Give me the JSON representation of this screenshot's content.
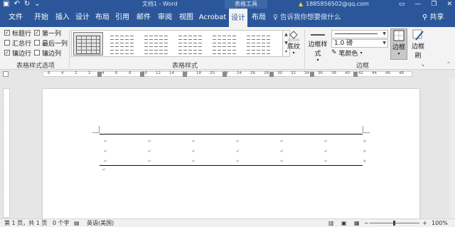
{
  "titlebar": {
    "doc_title": "文档1 - Word",
    "context_title": "表格工具",
    "account": "1885856502@qq.com",
    "qat_icons": [
      "save-icon",
      "undo-icon",
      "redo-icon",
      "quick-access-dropdown-icon"
    ],
    "window_buttons": [
      "ribbon-display-options-icon",
      "minimize-icon",
      "restore-icon",
      "close-icon"
    ]
  },
  "tabs": [
    {
      "label": "文件"
    },
    {
      "label": "开始"
    },
    {
      "label": "插入"
    },
    {
      "label": "设计"
    },
    {
      "label": "布局"
    },
    {
      "label": "引用"
    },
    {
      "label": "邮件"
    },
    {
      "label": "审阅"
    },
    {
      "label": "视图"
    },
    {
      "label": "Acrobat"
    },
    {
      "label": "设计"
    },
    {
      "label": "布局"
    }
  ],
  "tell_me": "告诉我你想要做什么",
  "share": "共享",
  "ribbon": {
    "style_options": {
      "label": "表格样式选项",
      "checkboxes": [
        {
          "label": "标题行",
          "checked": true
        },
        {
          "label": "第一列",
          "checked": true
        },
        {
          "label": "汇总行",
          "checked": false
        },
        {
          "label": "最后一列",
          "checked": false
        },
        {
          "label": "镶边行",
          "checked": true
        },
        {
          "label": "镶边列",
          "checked": false
        }
      ]
    },
    "table_styles": {
      "label": "表格样式"
    },
    "shading": {
      "label": "底纹"
    },
    "borders_group": {
      "label": "边框",
      "border_styles": "边框样式",
      "pen_weight": "1.0 磅",
      "pen_color": "笔颜色",
      "borders": "边框",
      "border_painter": "边框刷"
    }
  },
  "ruler": {
    "numbers": [
      "6",
      "4",
      "2",
      "2",
      "4",
      "6",
      "8",
      "10",
      "12",
      "14",
      "16",
      "18",
      "20",
      "22",
      "24",
      "26",
      "28",
      "30",
      "32",
      "34",
      "36",
      "38",
      "40",
      "42",
      "44",
      "46",
      "48"
    ]
  },
  "status": {
    "page": "第 1 页，共 1 页",
    "words": "0 个字",
    "language": "英语(美国)",
    "zoom": "100%",
    "zoom_minus": "−",
    "zoom_plus": "+"
  },
  "colors": {
    "brand_blue": "#2b579a",
    "ribbon_bg": "#f3f3f3"
  }
}
